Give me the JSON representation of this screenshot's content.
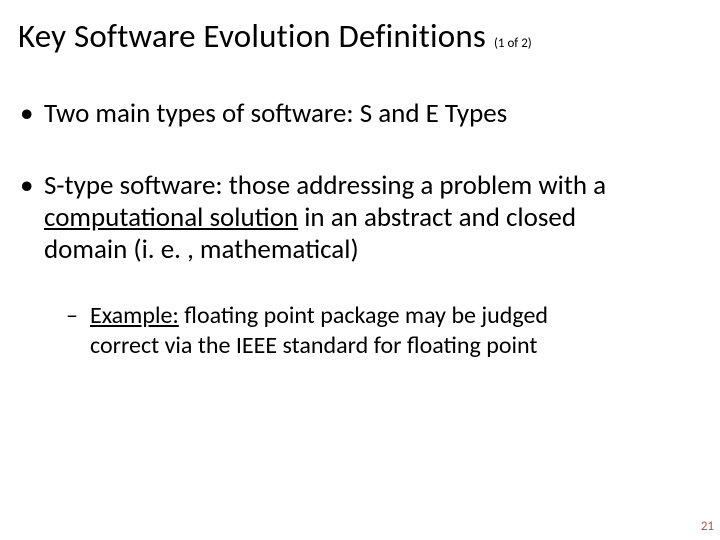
{
  "title": "Key Software Evolution Definitions",
  "pager": "(1 of 2)",
  "bullets": {
    "b1": "Two main types of software: S and E Types",
    "b2_pre": "S-type software: those addressing a problem with a ",
    "b2_u": "computational solution",
    "b2_post": " in an abstract and closed domain (i. e. , mathematical)",
    "ex_label": "Example:",
    "ex_rest": " floating point package may be judged correct via the IEEE standard for floating point"
  },
  "pagenum": "21"
}
